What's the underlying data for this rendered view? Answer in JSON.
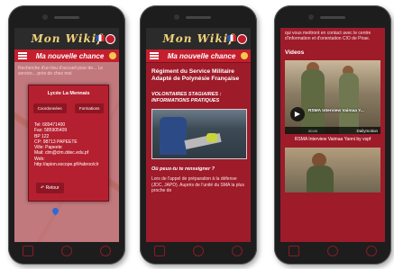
{
  "app": {
    "logo_text": "Mon Wikif",
    "page_title": "Ma nouvelle chance"
  },
  "phone1": {
    "map_text": "Recherche d'un lieu d'accueil pour de... Le service... près de chez moi",
    "modal_title": "Lycée La Mennais",
    "buttons": [
      "Coordonnées",
      "Formations"
    ],
    "info_lines": [
      "Tel: 689471400",
      "Fax: 585905409",
      "BP 122",
      "CP: 98713 PAPEETE",
      "Ville: Papeete",
      "Mail: clm@clm.ddec.edu.pf",
      "Web:",
      "http://apion.escope.pf/#abroo/clr"
    ],
    "back_label": "Retour"
  },
  "phone2": {
    "heading": "Régiment du Service Militaire Adapté de Polynésie Française",
    "subheading": "VOLONTAIRES STAGIAIRES : INFORMATIONS PRATIQUES",
    "question": "Où peux-tu te renseigner ?",
    "paragraph": "Lors de l'appel de préparation à la défense (JDC, JAPD). Auprès de l'unité du SMA la plus proche de"
  },
  "phone3": {
    "intro": "qui vous mettront en contact avec le centre d'information et d'orientation CIO de Pirae.",
    "section": "Videos",
    "video_title": "RSMA Interview Vaimaa Y...",
    "video_time": "00:00",
    "video_brand": "Dailymotion",
    "caption": "RSMA Interview Vaimaa Yanni by vspf"
  },
  "colors": {
    "primary": "#9e1b2a",
    "header": "#c41f2f",
    "logo": "#f0d27a"
  }
}
